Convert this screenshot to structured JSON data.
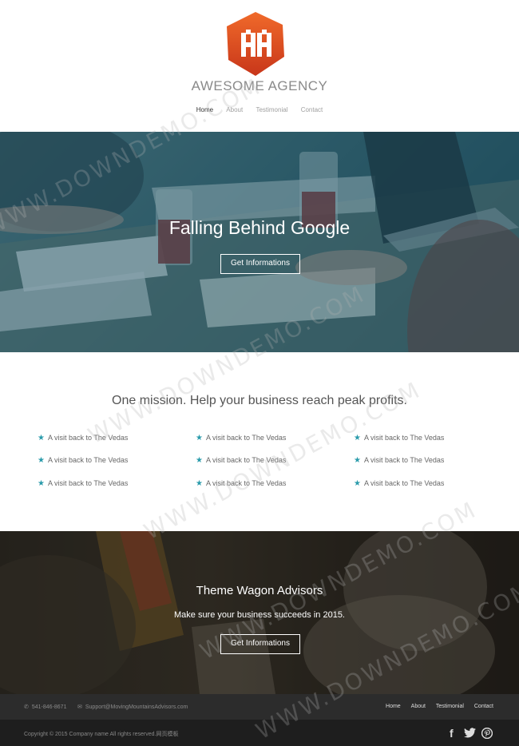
{
  "brand": {
    "name": "AWESOME AGENCY",
    "badge_color": "#e8531f",
    "badge_color_dark": "#c23a14"
  },
  "nav": {
    "items": [
      "Home",
      "About",
      "Testimonial",
      "Contact"
    ],
    "active": "Home"
  },
  "hero": {
    "title": "Falling Behind Google",
    "button_label": "Get Informations"
  },
  "mission": {
    "title": "One mission. Help your business reach peak profits.",
    "features": [
      "A visit back to The Vedas",
      "A visit back to The Vedas",
      "A visit back to The Vedas",
      "A visit back to The Vedas",
      "A visit back to The Vedas",
      "A visit back to The Vedas",
      "A visit back to The Vedas",
      "A visit back to The Vedas",
      "A visit back to The Vedas"
    ],
    "star_color": "#2a9bab"
  },
  "advisors": {
    "title": "Theme Wagon Advisors",
    "subtitle": "Make sure your business succeeds in 2015.",
    "button_label": "Get Informations"
  },
  "footer": {
    "phone": "541-846-8671",
    "email": "Support@MovingMountainsAdvisors.com",
    "nav": [
      "Home",
      "About",
      "Testimonial",
      "Contact"
    ],
    "copyright": "Copyright © 2015 Company name All rights reserved.网页模板",
    "social": [
      "facebook",
      "twitter",
      "pinterest"
    ]
  },
  "watermark": "WWW.DOWNDEMO.COM"
}
